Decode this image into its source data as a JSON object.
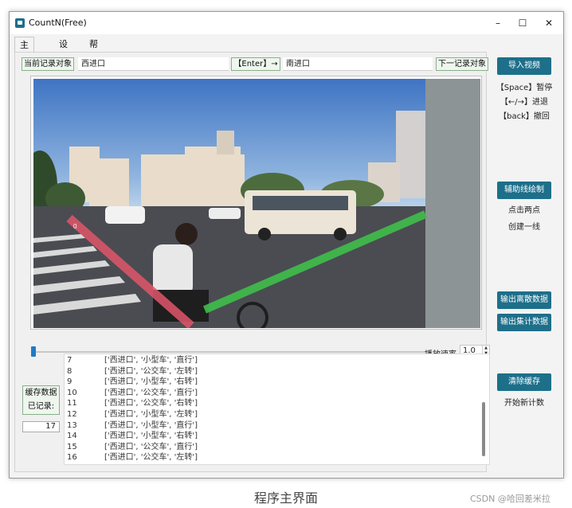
{
  "window": {
    "title": "CountN(Free)",
    "minimize": "–",
    "maximize": "☐",
    "close": "✕"
  },
  "tabs": [
    {
      "label": "主页面"
    },
    {
      "label": "设置"
    },
    {
      "label": "帮助"
    }
  ],
  "record": {
    "current_label": "当前记录对象",
    "current_value": "西进口",
    "enter_button": "【Enter】→",
    "next_value": "南进口",
    "next_label": "下一记录对象"
  },
  "playback": {
    "speed_label": "播放速率",
    "speed_value": "1.0",
    "progress": 0.0
  },
  "log": {
    "rows": [
      {
        "idx": "7",
        "value": "['西进口', '小型车', '直行']"
      },
      {
        "idx": "8",
        "value": "['西进口', '公交车', '左转']"
      },
      {
        "idx": "9",
        "value": "['西进口', '小型车', '右转']"
      },
      {
        "idx": "10",
        "value": "['西进口', '公交车', '直行']"
      },
      {
        "idx": "11",
        "value": "['西进口', '公交车', '右转']"
      },
      {
        "idx": "12",
        "value": "['西进口', '小型车', '左转']"
      },
      {
        "idx": "13",
        "value": "['西进口', '小型车', '直行']"
      },
      {
        "idx": "14",
        "value": "['西进口', '小型车', '右转']"
      },
      {
        "idx": "15",
        "value": "['西进口', '公交车', '直行']"
      },
      {
        "idx": "16",
        "value": "['西进口', '公交车', '左转']"
      }
    ]
  },
  "cache": {
    "title": "缓存数据",
    "recorded_label": "已记录:",
    "count": "17"
  },
  "sidebar": {
    "import_video": "导入视频",
    "hint_space": "【Space】暂停",
    "hint_arrows": "【←/→】进退",
    "hint_back": "【back】撤回",
    "draw_lines": "辅助线绘制",
    "hint_click": "点击两点",
    "hint_create": "创建一线",
    "export_discrete": "输出离散数据",
    "export_aggregate": "输出集计数据",
    "clear_cache": "清除缓存",
    "hint_restart": "开始新计数"
  },
  "colors": {
    "accent": "#1d6f8a",
    "line_red": "#e0566a",
    "line_green": "#3fbf4a"
  },
  "caption": "程序主界面",
  "watermark": "CSDN @哈回差米拉"
}
